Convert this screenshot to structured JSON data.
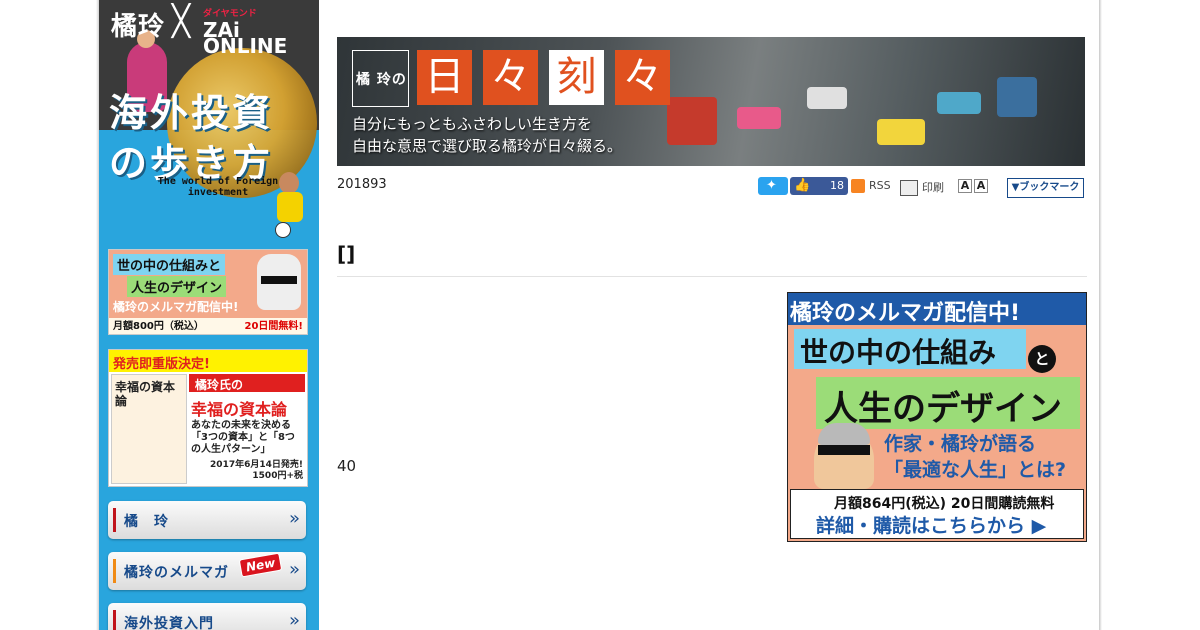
{
  "sidebar": {
    "hero": {
      "brand": "橘玲",
      "brand_x": "╳",
      "brand_zai_top": "ダイヤモンド",
      "brand_zai": "ZAi ONLINE",
      "title_line1": "海外投資",
      "title_line2": "の歩き方",
      "subtitle": "The world of Foreign investment"
    },
    "ad_newsletter": {
      "line1": "世の中の仕組みと",
      "line2": "人生のデザイン",
      "line3": "橘玲のメルマガ配信中!",
      "price": "月額800円（税込）",
      "trial": "20日間無料!"
    },
    "ad_book": {
      "banner": "発売即重版決定!",
      "book_title": "幸福の資本論",
      "author_tag": "橘玲氏の",
      "headline": "幸福の資本論",
      "desc": "あなたの未来を決める「3つの資本」と「8つの人生パターン」",
      "release": "2017年6月14日発売! 1500円+税"
    },
    "nav": [
      {
        "label": "橘　玲",
        "accent": "#c0141b"
      },
      {
        "label": "橘玲のメルマガ",
        "accent": "#f08a14",
        "badge": "New"
      },
      {
        "label": "海外投資入門",
        "accent": "#c0141b"
      }
    ],
    "nav_chevron": "»"
  },
  "banner": {
    "name": "橘 玲の",
    "tiles": [
      "日",
      "々",
      "刻",
      "々"
    ],
    "tagline_line1": "自分にもっともふさわしい生き方を",
    "tagline_line2": "自由な意思で選び取る橘玲が日々綴る。"
  },
  "meta": {
    "date": "201893",
    "like_count": "18",
    "rss_label": "RSS",
    "print_label": "印刷",
    "font_size_labels": [
      "A",
      "A"
    ],
    "bookmark_label": "▼ブックマーク"
  },
  "article": {
    "title": "[]",
    "body": "40"
  },
  "ad_right": {
    "top": "橘玲のメルマガ配信中!",
    "line1": "世の中の仕組み",
    "to": "と",
    "line2": "人生のデザイン",
    "line3a": "作家・橘玲が語る",
    "line3b": "「最適な人生」とは?",
    "price": "月額864円(税込) 20日間購読無料",
    "cta": "詳細・購読はこちらから ▶"
  },
  "colors": {
    "sidebar_bg": "#29a5dd",
    "banner_tile": "#e0511f",
    "link_blue": "#174a8a",
    "twitter": "#2aa3ef",
    "facebook": "#3b5998"
  }
}
